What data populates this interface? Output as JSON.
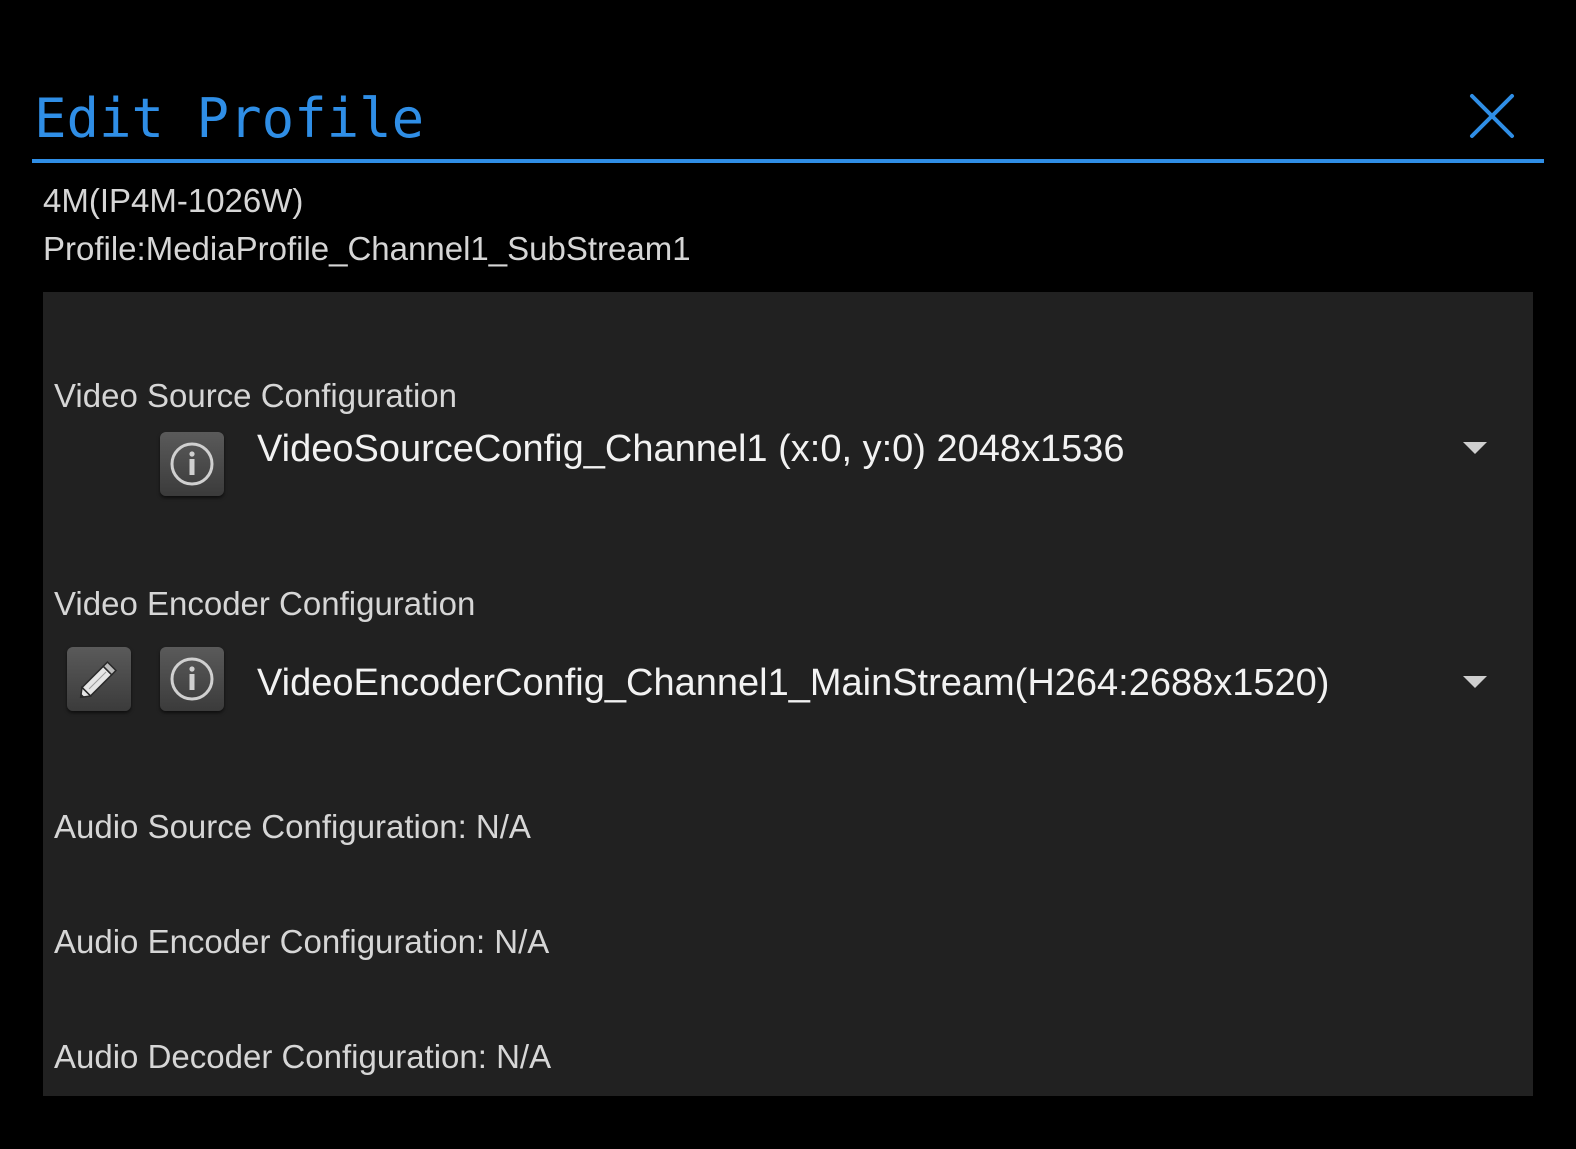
{
  "dialog": {
    "title": "Edit Profile",
    "close_icon": "close-icon"
  },
  "device": {
    "name": "4M(IP4M-1026W)",
    "profile": "Profile:MediaProfile_Channel1_SubStream1"
  },
  "video_source": {
    "label": "Video Source Configuration",
    "selected": "VideoSourceConfig_Channel1 (x:0, y:0) 2048x1536",
    "info_icon": "info-icon"
  },
  "video_encoder": {
    "label": "Video Encoder Configuration",
    "selected": "VideoEncoderConfig_Channel1_MainStream(H264:2688x1520)",
    "edit_icon": "pencil-icon",
    "info_icon": "info-icon"
  },
  "audio": {
    "source": "Audio Source Configuration: N/A",
    "encoder": "Audio Encoder Configuration: N/A",
    "decoder": "Audio Decoder Configuration: N/A"
  },
  "colors": {
    "accent": "#2f8ee6",
    "background": "#000000",
    "panel": "#212121",
    "text": "#d6d6d6"
  }
}
